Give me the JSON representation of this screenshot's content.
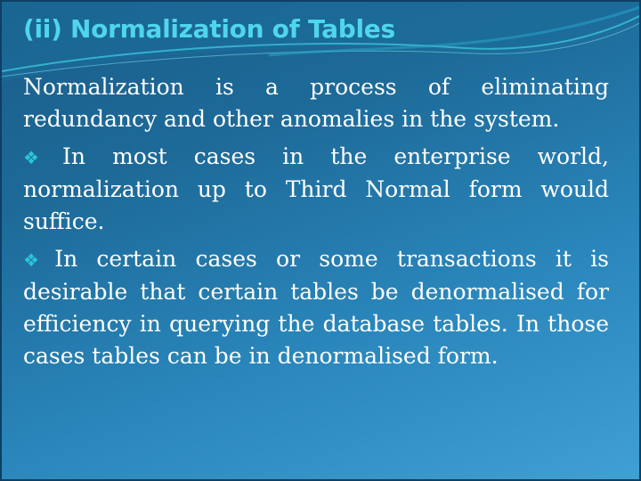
{
  "slide": {
    "title": "(ii) Normalization of Tables",
    "colors": {
      "title": "#4fd6ec",
      "bullet": "#2ac6d8",
      "text": "#ffffff",
      "background_top": "#1a5d8a",
      "background_bottom": "#409fd3"
    },
    "paragraphs": [
      {
        "bullet": false,
        "text": "Normalization is a process of eliminating redundancy and other anomalies in the system."
      },
      {
        "bullet": true,
        "bullet_icon": "❖",
        "text": "In most cases in the enterprise world, normalization up to Third Normal form would suffice."
      },
      {
        "bullet": true,
        "bullet_icon": "❖",
        "text": "In certain cases or some transactions it is desirable that certain tables be denormalised for efficiency in querying the database tables. In those cases tables can be in denormalised form."
      }
    ]
  }
}
